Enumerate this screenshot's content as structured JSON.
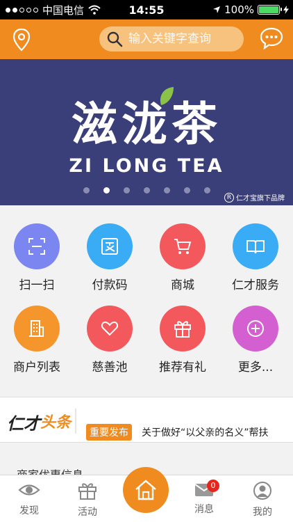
{
  "status_bar": {
    "carrier": "中国电信",
    "time": "14:55",
    "battery": "100%",
    "battery_level": 1.0
  },
  "header": {
    "search_placeholder": "输入关键字查询",
    "colors": {
      "primary": "#f08c1f",
      "search_bg": "#f7c27e"
    }
  },
  "banner": {
    "brand_cn": "滋泷茶",
    "brand_en": "ZI LONG TEA",
    "sub_brand_mark": "R",
    "sub_brand": "仁才宝旗下品牌",
    "page_count": 7,
    "active_page": 2,
    "bg_color": "#3a3f7a"
  },
  "grid": {
    "items": [
      {
        "label": "扫一扫",
        "icon": "scan-icon",
        "color": "#7b86f0"
      },
      {
        "label": "付款码",
        "icon": "pay-code-icon",
        "color": "#3aabf5"
      },
      {
        "label": "商城",
        "icon": "shopping-cart-icon",
        "color": "#f2585c"
      },
      {
        "label": "仁才服务",
        "icon": "book-icon",
        "color": "#3aabf5"
      },
      {
        "label": "商户列表",
        "icon": "building-icon",
        "color": "#f5962c"
      },
      {
        "label": "慈善池",
        "icon": "heart-icon",
        "color": "#f2585c"
      },
      {
        "label": "推荐有礼",
        "icon": "gift-icon",
        "color": "#f2585c"
      },
      {
        "label": "更多...",
        "icon": "plus-icon",
        "color": "#d45fd0"
      }
    ]
  },
  "news": {
    "logo_part1": "仁才",
    "logo_part2": "头条",
    "tag": "重要发布",
    "headline": "关于做好“以父亲的名义”帮扶"
  },
  "merchant": {
    "title": "商家优惠信息"
  },
  "tabbar": {
    "tabs": [
      {
        "label": "发现",
        "icon": "eye-icon"
      },
      {
        "label": "活动",
        "icon": "gift-icon"
      },
      {
        "label": "",
        "icon": "home-icon"
      },
      {
        "label": "消息",
        "icon": "mail-icon",
        "badge": "0"
      },
      {
        "label": "我的",
        "icon": "user-icon"
      }
    ]
  }
}
